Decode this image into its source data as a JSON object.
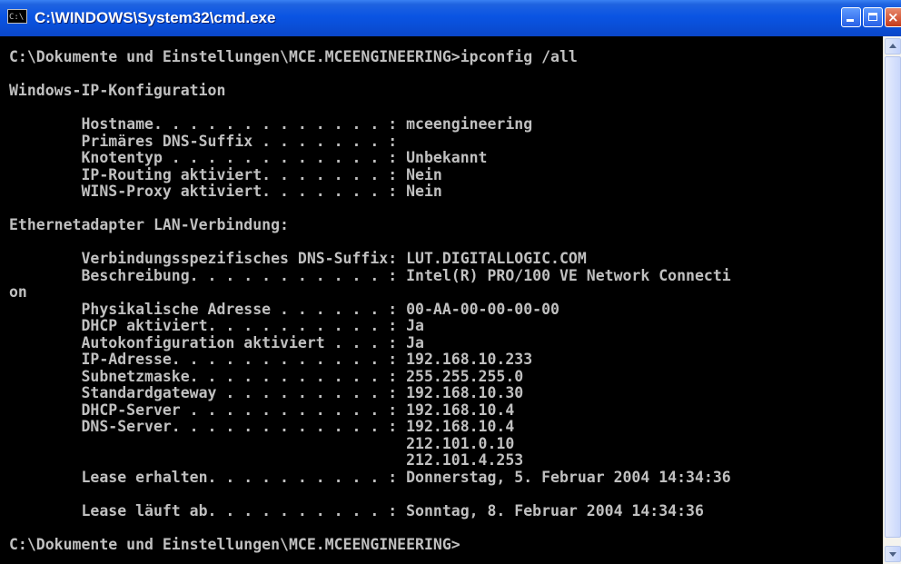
{
  "window": {
    "title": "C:\\WINDOWS\\System32\\cmd.exe",
    "icon_label": "C:\\"
  },
  "console": {
    "text": "C:\\Dokumente und Einstellungen\\MCE.MCEENGINEERING>ipconfig /all\n\nWindows-IP-Konfiguration\n\n        Hostname. . . . . . . . . . . . . : mceengineering\n        Primäres DNS-Suffix . . . . . . . :\n        Knotentyp . . . . . . . . . . . . : Unbekannt\n        IP-Routing aktiviert. . . . . . . : Nein\n        WINS-Proxy aktiviert. . . . . . . : Nein\n\nEthernetadapter LAN-Verbindung:\n\n        Verbindungsspezifisches DNS-Suffix: LUT.DIGITALLOGIC.COM\n        Beschreibung. . . . . . . . . . . : Intel(R) PRO/100 VE Network Connecti\non\n        Physikalische Adresse . . . . . . : 00-AA-00-00-00-00\n        DHCP aktiviert. . . . . . . . . . : Ja\n        Autokonfiguration aktiviert . . . : Ja\n        IP-Adresse. . . . . . . . . . . . : 192.168.10.233\n        Subnetzmaske. . . . . . . . . . . : 255.255.255.0\n        Standardgateway . . . . . . . . . : 192.168.10.30\n        DHCP-Server . . . . . . . . . . . : 192.168.10.4\n        DNS-Server. . . . . . . . . . . . : 192.168.10.4\n                                            212.101.0.10\n                                            212.101.4.253\n        Lease erhalten. . . . . . . . . . : Donnerstag, 5. Februar 2004 14:34:36\n\n        Lease läuft ab. . . . . . . . . . : Sonntag, 8. Februar 2004 14:34:36\n\nC:\\Dokumente und Einstellungen\\MCE.MCEENGINEERING>"
  },
  "colors": {
    "titlebar": "#0a54e3",
    "console_bg": "#000000",
    "console_fg": "#c0c0c0"
  }
}
